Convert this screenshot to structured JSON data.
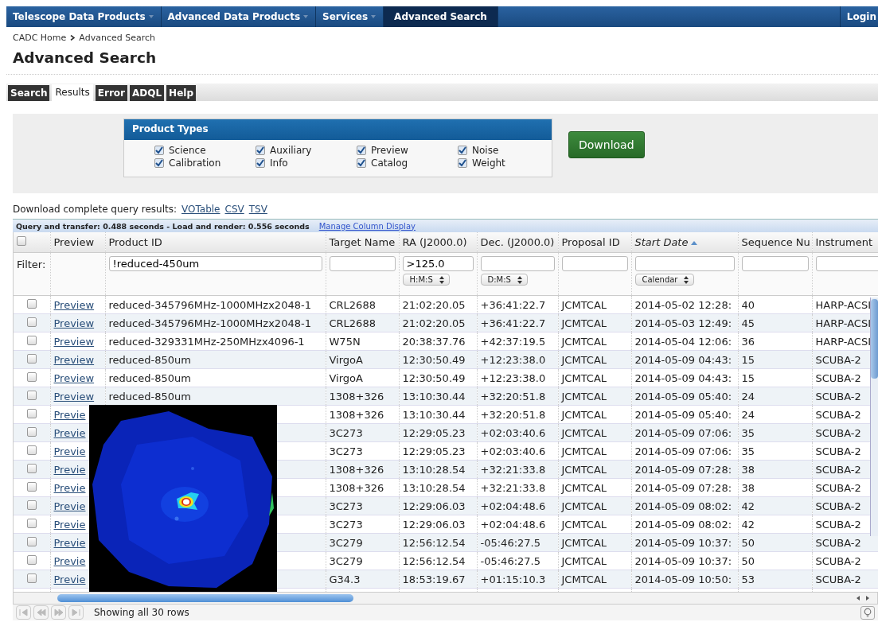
{
  "nav": {
    "items": [
      {
        "label": "Telescope Data Products",
        "dropdown": true,
        "selected": false
      },
      {
        "label": "Advanced Data Products",
        "dropdown": true,
        "selected": false
      },
      {
        "label": "Services",
        "dropdown": true,
        "selected": false
      },
      {
        "label": "Advanced Search",
        "dropdown": false,
        "selected": true
      }
    ],
    "login": "Login"
  },
  "breadcrumb": [
    {
      "label": "CADC Home"
    },
    {
      "label": "Advanced Search"
    }
  ],
  "title": "Advanced Search",
  "tabs": [
    {
      "label": "Search",
      "selected": false
    },
    {
      "label": "Results",
      "selected": true
    },
    {
      "label": "Error",
      "selected": false
    },
    {
      "label": "ADQL",
      "selected": false
    },
    {
      "label": "Help",
      "selected": false
    }
  ],
  "product_types": {
    "title": "Product Types",
    "items": [
      {
        "label": "Science",
        "checked": true
      },
      {
        "label": "Auxiliary",
        "checked": true
      },
      {
        "label": "Preview",
        "checked": true
      },
      {
        "label": "Noise",
        "checked": true
      },
      {
        "label": "Calibration",
        "checked": true
      },
      {
        "label": "Info",
        "checked": true
      },
      {
        "label": "Catalog",
        "checked": true
      },
      {
        "label": "Weight",
        "checked": true
      }
    ]
  },
  "download_button": "Download",
  "download_links": {
    "label": "Download complete query results:",
    "links": [
      "VOTable",
      "CSV",
      "TSV"
    ]
  },
  "grid": {
    "timing": "Query and transfer: 0.488 seconds - Load and render: 0.556 seconds",
    "manage_link": "Manage Column Display",
    "columns": [
      {
        "kind": "checkbox",
        "checked": false
      },
      {
        "kind": "text",
        "label": "Preview"
      },
      {
        "kind": "text",
        "label": "Product ID"
      },
      {
        "kind": "text",
        "label": "Target Name"
      },
      {
        "kind": "text",
        "label": "RA (J2000.0)"
      },
      {
        "kind": "text",
        "label": "Dec. (J2000.0)"
      },
      {
        "kind": "text",
        "label": "Proposal ID"
      },
      {
        "kind": "text",
        "label": "Start Date",
        "sorted": true
      },
      {
        "kind": "text",
        "label": "Sequence Nu"
      },
      {
        "kind": "text",
        "label": "Instrument"
      }
    ],
    "filter_label": "Filter:",
    "filters": [
      {
        "kind": "none"
      },
      {
        "kind": "text",
        "value": "!reduced-450um"
      },
      {
        "kind": "text"
      },
      {
        "kind": "text",
        "value": ">125.0",
        "format": "H:M:S"
      },
      {
        "kind": "text",
        "format": "D:M:S"
      },
      {
        "kind": "text"
      },
      {
        "kind": "text",
        "format": "Calendar"
      },
      {
        "kind": "text"
      },
      {
        "kind": "text"
      }
    ],
    "rows": [
      {
        "checked": false,
        "preview": "Preview",
        "product_id": "reduced-345796MHz-1000MHzx2048-1",
        "target": "CRL2688",
        "ra": "21:02:20.05",
        "dec": "+36:41:22.7",
        "proposal": "JCMTCAL",
        "start": "2014-05-02 12:28:",
        "sequence": "40",
        "instrument": "HARP-ACSI"
      },
      {
        "checked": false,
        "preview": "Preview",
        "product_id": "reduced-345796MHz-1000MHzx2048-1",
        "target": "CRL2688",
        "ra": "21:02:20.05",
        "dec": "+36:41:22.7",
        "proposal": "JCMTCAL",
        "start": "2014-05-03 12:49:",
        "sequence": "45",
        "instrument": "HARP-ACSI"
      },
      {
        "checked": false,
        "preview": "Preview",
        "product_id": "reduced-329331MHz-250MHzx4096-1",
        "target": "W75N",
        "ra": "20:38:37.76",
        "dec": "+42:37:19.5",
        "proposal": "JCMTCAL",
        "start": "2014-05-04 12:06:",
        "sequence": "36",
        "instrument": "HARP-ACSI"
      },
      {
        "checked": false,
        "preview": "Preview",
        "product_id": "reduced-850um",
        "target": "VirgoA",
        "ra": "12:30:50.49",
        "dec": "+12:23:38.0",
        "proposal": "JCMTCAL",
        "start": "2014-05-09 04:43:",
        "sequence": "15",
        "instrument": "SCUBA-2"
      },
      {
        "checked": false,
        "preview": "Preview",
        "product_id": "reduced-850um",
        "target": "VirgoA",
        "ra": "12:30:50.49",
        "dec": "+12:23:38.0",
        "proposal": "JCMTCAL",
        "start": "2014-05-09 04:43:",
        "sequence": "15",
        "instrument": "SCUBA-2"
      },
      {
        "checked": false,
        "preview": "Preview",
        "product_id": "reduced-850um",
        "target": "1308+326",
        "ra": "13:10:30.44",
        "dec": "+32:20:51.8",
        "proposal": "JCMTCAL",
        "start": "2014-05-09 05:40:",
        "sequence": "24",
        "instrument": "SCUBA-2"
      },
      {
        "checked": false,
        "preview": "Previe",
        "target": "1308+326",
        "ra": "13:10:30.44",
        "dec": "+32:20:51.8",
        "proposal": "JCMTCAL",
        "start": "2014-05-09 05:40:",
        "sequence": "24",
        "instrument": "SCUBA-2"
      },
      {
        "checked": false,
        "preview": "Previe",
        "target": "3C273",
        "ra": "12:29:05.23",
        "dec": "+02:03:40.6",
        "proposal": "JCMTCAL",
        "start": "2014-05-09 07:06:",
        "sequence": "35",
        "instrument": "SCUBA-2"
      },
      {
        "checked": false,
        "preview": "Previe",
        "target": "3C273",
        "ra": "12:29:05.23",
        "dec": "+02:03:40.6",
        "proposal": "JCMTCAL",
        "start": "2014-05-09 07:06:",
        "sequence": "35",
        "instrument": "SCUBA-2"
      },
      {
        "checked": false,
        "preview": "Previe",
        "target": "1308+326",
        "ra": "13:10:28.54",
        "dec": "+32:21:33.8",
        "proposal": "JCMTCAL",
        "start": "2014-05-09 07:28:",
        "sequence": "38",
        "instrument": "SCUBA-2"
      },
      {
        "checked": false,
        "preview": "Previe",
        "target": "1308+326",
        "ra": "13:10:28.54",
        "dec": "+32:21:33.8",
        "proposal": "JCMTCAL",
        "start": "2014-05-09 07:28:",
        "sequence": "38",
        "instrument": "SCUBA-2"
      },
      {
        "checked": false,
        "preview": "Previe",
        "target": "3C273",
        "ra": "12:29:06.03",
        "dec": "+02:04:48.6",
        "proposal": "JCMTCAL",
        "start": "2014-05-09 08:02:",
        "sequence": "42",
        "instrument": "SCUBA-2"
      },
      {
        "checked": false,
        "preview": "Previe",
        "target": "3C273",
        "ra": "12:29:06.03",
        "dec": "+02:04:48.6",
        "proposal": "JCMTCAL",
        "start": "2014-05-09 08:02:",
        "sequence": "42",
        "instrument": "SCUBA-2"
      },
      {
        "checked": false,
        "preview": "Previe",
        "target": "3C279",
        "ra": "12:56:12.54",
        "dec": "-05:46:27.5",
        "proposal": "JCMTCAL",
        "start": "2014-05-09 10:37:",
        "sequence": "50",
        "instrument": "SCUBA-2"
      },
      {
        "checked": false,
        "preview": "Previe",
        "target": "3C279",
        "ra": "12:56:12.54",
        "dec": "-05:46:27.5",
        "proposal": "JCMTCAL",
        "start": "2014-05-09 10:37:",
        "sequence": "50",
        "instrument": "SCUBA-2"
      },
      {
        "checked": false,
        "preview": "Previe",
        "target": "G34.3",
        "ra": "18:53:19.67",
        "dec": "+01:15:10.3",
        "proposal": "JCMTCAL",
        "start": "2014-05-09 10:50:",
        "sequence": "53",
        "instrument": "SCUBA-2"
      }
    ],
    "status": "Showing all 30 rows"
  }
}
